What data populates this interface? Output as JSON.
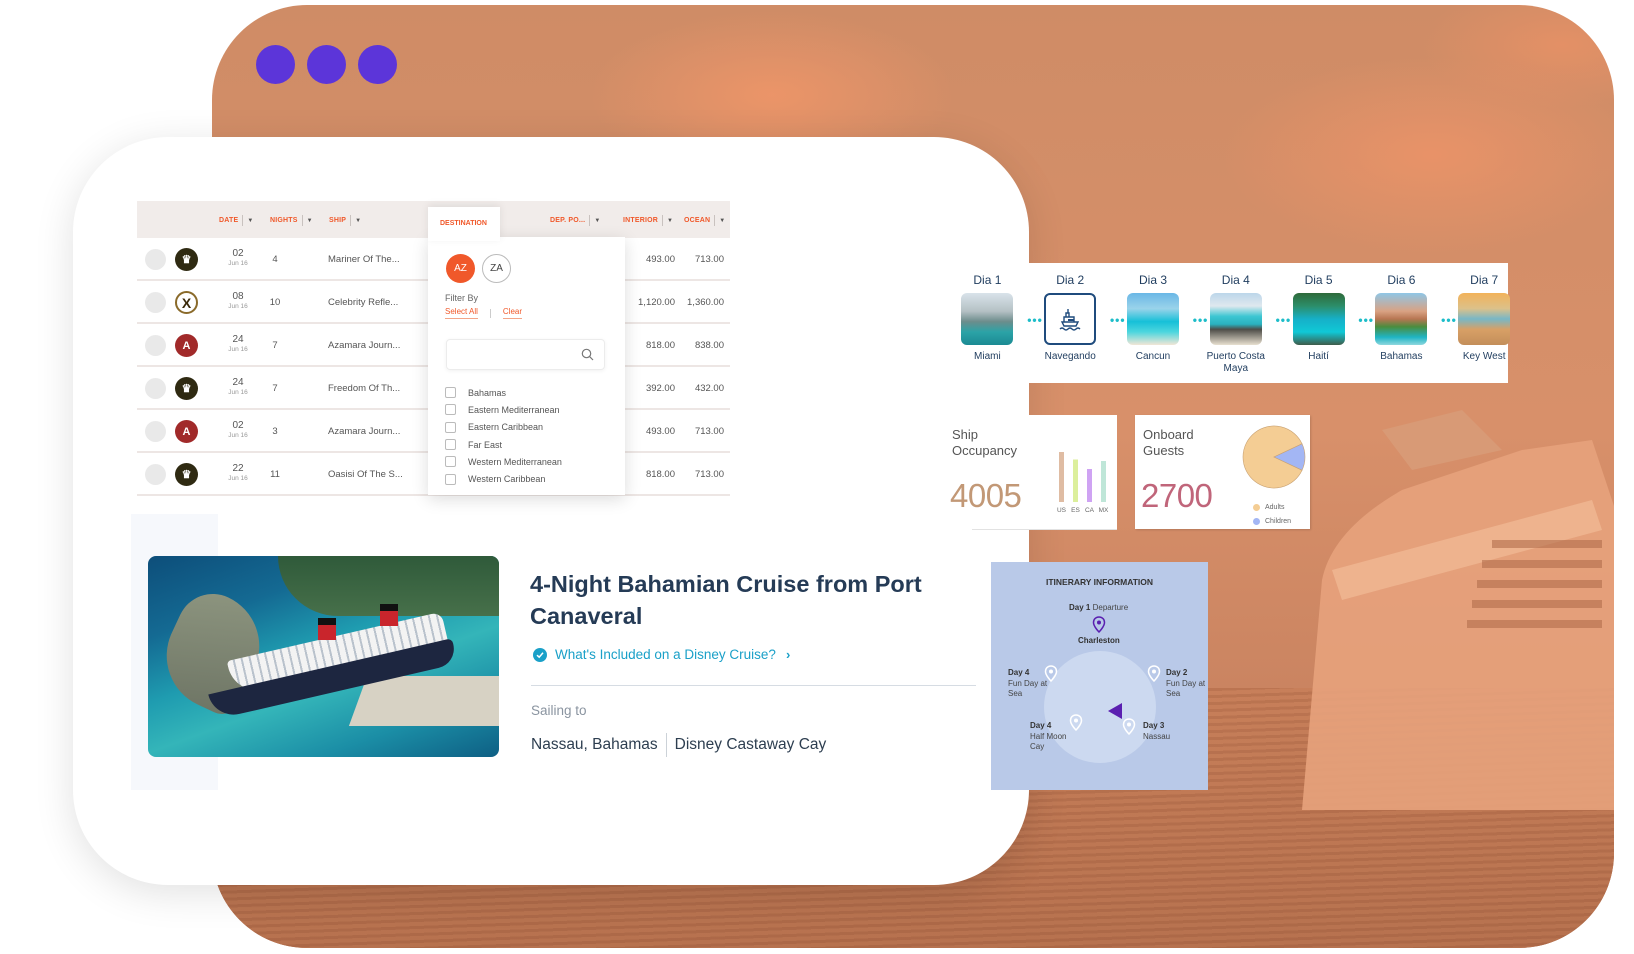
{
  "window": {
    "controls": [
      "dot-1",
      "dot-2",
      "dot-3"
    ],
    "accent": "#5c35d9",
    "background_tint": "#d48c66"
  },
  "cruise_grid": {
    "accent": "#f0582a",
    "columns": [
      {
        "key": "date",
        "label": "DATE",
        "sortable": true
      },
      {
        "key": "nights",
        "label": "NIGHTS",
        "sortable": true
      },
      {
        "key": "ship",
        "label": "SHIP",
        "sortable": true
      },
      {
        "key": "destination",
        "label": "DESTINATION",
        "sortable": false,
        "active": true
      },
      {
        "key": "dep_port",
        "label": "DEP. PO...",
        "sortable": true
      },
      {
        "key": "interior",
        "label": "INTERIOR",
        "sortable": true
      },
      {
        "key": "ocean",
        "label": "OCEAN",
        "sortable": true
      }
    ],
    "rows": [
      {
        "line": "royal-caribbean",
        "day": "02",
        "month": "Jun 16",
        "nights": "4",
        "ship": "Mariner Of The...",
        "interior": "493.00",
        "ocean": "713.00"
      },
      {
        "line": "celebrity",
        "day": "08",
        "month": "Jun 16",
        "nights": "10",
        "ship": "Celebrity Refle...",
        "interior": "1,120.00",
        "ocean": "1,360.00"
      },
      {
        "line": "azamara",
        "day": "24",
        "month": "Jun 16",
        "nights": "7",
        "ship": "Azamara Journ...",
        "interior": "818.00",
        "ocean": "838.00"
      },
      {
        "line": "royal-caribbean",
        "day": "24",
        "month": "Jun 16",
        "nights": "7",
        "ship": "Freedom Of Th...",
        "interior": "392.00",
        "ocean": "432.00"
      },
      {
        "line": "azamara",
        "day": "02",
        "month": "Jun 16",
        "nights": "3",
        "ship": "Azamara Journ...",
        "interior": "493.00",
        "ocean": "713.00"
      },
      {
        "line": "royal-caribbean",
        "day": "22",
        "month": "Jun 16",
        "nights": "11",
        "ship": "Oasisi Of The S...",
        "interior": "818.00",
        "ocean": "713.00"
      }
    ],
    "destination_filter": {
      "sort_asc": "AZ",
      "sort_desc": "ZA",
      "sort_active": "asc",
      "filter_by_label": "Filter By",
      "select_all_label": "Select All",
      "clear_label": "Clear",
      "search_value": "",
      "search_icon": "search-icon",
      "options": [
        {
          "label": "Bahamas",
          "checked": false
        },
        {
          "label": "Eastern Mediterranean",
          "checked": false
        },
        {
          "label": "Eastern Caribbean",
          "checked": false
        },
        {
          "label": "Far East",
          "checked": false
        },
        {
          "label": "Western Mediterranean",
          "checked": false
        },
        {
          "label": "Western Caribbean",
          "checked": false
        }
      ]
    }
  },
  "cruise_card": {
    "title": "4-Night Bahamian Cruise from Port Canaveral",
    "included_link": "What's Included on a Disney Cruise?",
    "included_icon": "check-circle-icon",
    "sailing_label": "Sailing to",
    "ports": [
      "Nassau, Bahamas",
      "Disney Castaway Cay"
    ],
    "link_color": "#1aa0c8",
    "title_color": "#253b56"
  },
  "day_strip": {
    "days": [
      {
        "label": "Dia 1",
        "place": "Miami"
      },
      {
        "label": "Dia 2",
        "place": "Navegando",
        "icon": "ship-icon"
      },
      {
        "label": "Dia 3",
        "place": "Cancun"
      },
      {
        "label": "Dia 4",
        "place": "Puerto Costa Maya"
      },
      {
        "label": "Dia 5",
        "place": "Haití"
      },
      {
        "label": "Dia 6",
        "place": "Bahamas"
      },
      {
        "label": "Dia 7",
        "place": "Key West"
      }
    ],
    "connector_color": "#1dbdc9"
  },
  "ship_occupancy": {
    "title_line1": "Ship",
    "title_line2": "Occupancy",
    "value": "4005",
    "value_color": "#c29876"
  },
  "onboard_guests": {
    "title_line1": "Onboard",
    "title_line2": "Guests",
    "value": "2700",
    "value_color": "#c0657a"
  },
  "itinerary": {
    "title": "ITINERARY INFORMATION",
    "stops": [
      {
        "day": "Day 1",
        "desc": "Departure",
        "place": "Charleston",
        "active": true
      },
      {
        "day": "Day 2",
        "desc": "Fun Day at Sea"
      },
      {
        "day": "Day 3",
        "desc": "Nassau"
      },
      {
        "day": "Day 4",
        "desc": "Half Moon Cay"
      },
      {
        "day": "Day 4",
        "desc": "Fun Day at Sea"
      }
    ],
    "accent": "#5a1fb0"
  },
  "chart_data": [
    {
      "type": "bar",
      "title": "Ship Occupancy",
      "categories": [
        "US",
        "ES",
        "CA",
        "MX"
      ],
      "values": [
        100,
        85,
        66,
        82
      ],
      "colors": [
        "#dfbca3",
        "#dcef9c",
        "#cfa3f3",
        "#bfe6d8"
      ],
      "xlabel": "",
      "ylabel": "",
      "ylim": [
        0,
        100
      ],
      "grid": false
    },
    {
      "type": "pie",
      "title": "Onboard Guests",
      "categories": [
        "Adults",
        "Children"
      ],
      "values": [
        86,
        14
      ],
      "colors": [
        "#f4cd94",
        "#a3b6f4"
      ],
      "legend": "bottom-right"
    }
  ]
}
